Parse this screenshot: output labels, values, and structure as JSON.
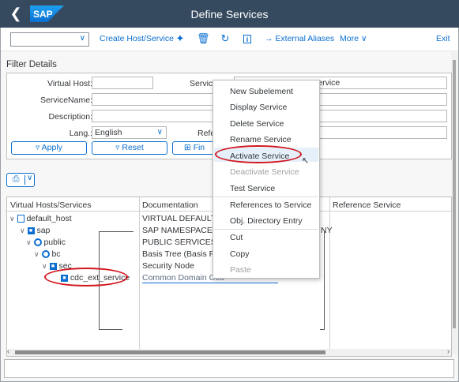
{
  "shell": {
    "title": "Define Services",
    "logo": "SAP",
    "back_icon": "back-icon"
  },
  "toolbar": {
    "dropdown_value": "",
    "create_host": "Create Host/Service",
    "external_aliases": "External Aliases",
    "more": "More",
    "exit": "Exit"
  },
  "filter": {
    "title": "Filter Details",
    "virtual_host_label": "Virtual Host:",
    "virtual_host_value": "",
    "service_label": "Service:",
    "service_value": "service",
    "service_name_label": "ServiceName:",
    "service_name_value": "",
    "description_label": "Description:",
    "description_value": "",
    "lang_label": "Lang.:",
    "lang_value": "English",
    "ref_label": "Refe",
    "apply": "Apply",
    "reset": "Reset",
    "find": "Fin"
  },
  "tree": {
    "columns": [
      "Virtual Hosts/Services",
      "Documentation",
      "Reference Service"
    ],
    "rows": [
      {
        "name": "default_host",
        "doc": "VIRTUAL DEFAULT HO",
        "extra": ""
      },
      {
        "name": "sap",
        "doc": "SAP NAMESPACE; SA",
        "extra": "NY"
      },
      {
        "name": "public",
        "doc": "PUBLIC SERVICES",
        "extra": ""
      },
      {
        "name": "bc",
        "doc": "Basis Tree (Basis Func",
        "extra": ""
      },
      {
        "name": "sec",
        "doc": "Security Node",
        "extra": ""
      },
      {
        "name": "cdc_ext_service",
        "doc": "Common Domain Coo",
        "extra": ""
      }
    ]
  },
  "menu": {
    "items": [
      {
        "label": "New Subelement",
        "disabled": false
      },
      {
        "label": "Display Service",
        "disabled": false
      },
      {
        "label": "Delete Service",
        "disabled": false
      },
      {
        "label": "Rename Service",
        "disabled": false
      },
      {
        "label": "Activate Service",
        "disabled": false
      },
      {
        "label": "Deactivate Service",
        "disabled": true
      },
      {
        "label": "Test Service",
        "disabled": false
      },
      {
        "label": "References to Service",
        "disabled": false
      },
      {
        "label": "Obj. Directory Entry",
        "disabled": false
      },
      {
        "label": "Cut",
        "disabled": false
      },
      {
        "label": "Copy",
        "disabled": false
      },
      {
        "label": "Paste",
        "disabled": true
      }
    ]
  },
  "colors": {
    "shell": "#354a5f",
    "accent": "#0a6ed1",
    "annotation": "#d2161e"
  }
}
